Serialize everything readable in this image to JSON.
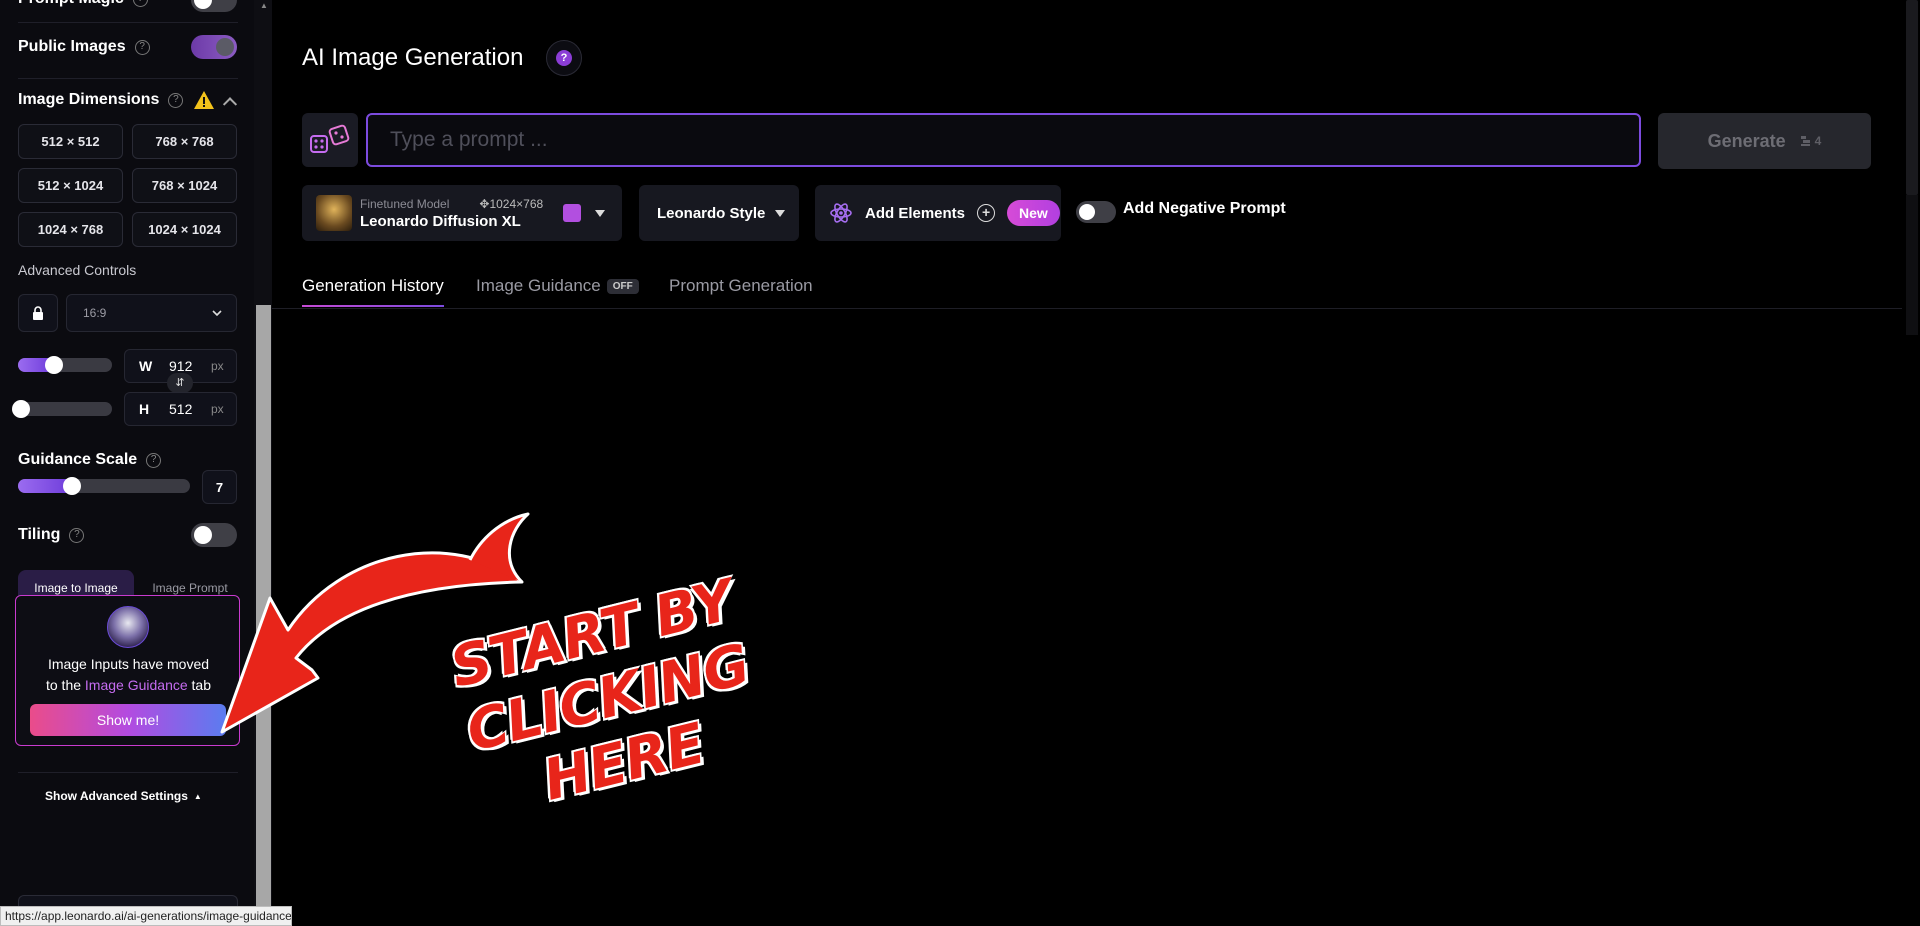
{
  "sidebar": {
    "prompt_magic_label": "Prompt Magic",
    "public_images_label": "Public Images",
    "image_dimensions_label": "Image Dimensions",
    "dimension_presets": [
      "512 × 512",
      "768 × 768",
      "512 × 1024",
      "768 × 1024",
      "1024 × 768",
      "1024 × 1024"
    ],
    "advanced_controls_label": "Advanced Controls",
    "aspect_ratio": "16:9",
    "width_label": "W",
    "width_value": "912",
    "height_label": "H",
    "height_value": "512",
    "unit": "px",
    "guidance_scale_label": "Guidance Scale",
    "guidance_scale_value": "7",
    "tiling_label": "Tiling",
    "tab_image_to_image": "Image to Image",
    "tab_image_prompt": "Image Prompt",
    "notice_line1": "Image Inputs have moved",
    "notice_line2_prefix": "to the ",
    "notice_link": "Image Guidance",
    "notice_line2_suffix": " tab",
    "show_me_button": "Show me!",
    "show_advanced_label": "Show Advanced Settings",
    "public_images_on": true,
    "tiling_on": false
  },
  "header": {
    "title": "AI Image Generation",
    "help_glyph": "?"
  },
  "prompt": {
    "placeholder": "Type a prompt ...",
    "generate_label": "Generate",
    "token_cost": "4"
  },
  "controls": {
    "model_sub_label": "Finetuned Model",
    "model_resolution": "1024×768",
    "model_name": "Leonardo Diffusion XL",
    "style_label": "Leonardo Style",
    "elements_label": "Add Elements",
    "new_badge": "New",
    "negative_prompt_label": "Add Negative Prompt"
  },
  "tabs": {
    "history": "Generation History",
    "guidance": "Image Guidance",
    "guidance_badge": "OFF",
    "prompt_generation": "Prompt Generation"
  },
  "annotation": {
    "lines": [
      "START BY",
      "CLICKING",
      "HERE"
    ]
  },
  "status_bar": {
    "url": "https://app.leonardo.ai/ai-generations/image-guidance"
  },
  "colors": {
    "accent_purple": "#7c4bde",
    "accent_pink": "#d64bd7",
    "annotation_red": "#e8251a"
  }
}
